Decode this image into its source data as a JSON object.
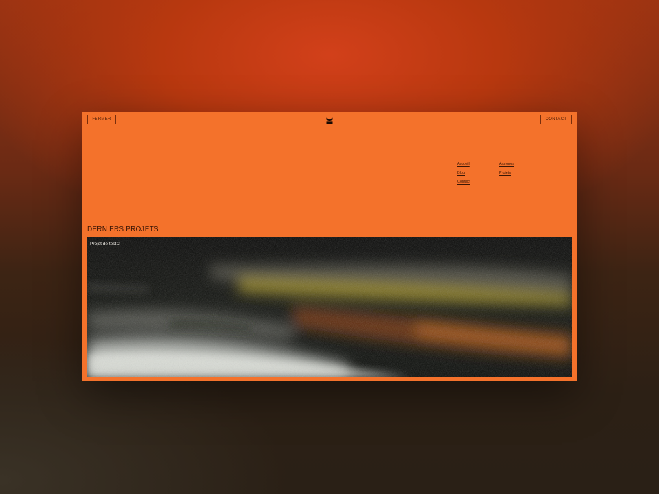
{
  "header": {
    "close_label": "FERMER",
    "contact_label": "CONTACT",
    "logo_icon": "brand-logo-icon"
  },
  "nav": {
    "items": [
      {
        "label": "Accueil"
      },
      {
        "label": "À propos"
      },
      {
        "label": "Blog"
      },
      {
        "label": "Projets"
      },
      {
        "label": "Contact"
      }
    ]
  },
  "projects": {
    "section_title": "DERNIERS PROJETS",
    "current": {
      "title": "Projet de test 2"
    },
    "slider_progress": 0.64
  },
  "colors": {
    "accent": "#f4722b",
    "text_dark": "#3a1606"
  }
}
